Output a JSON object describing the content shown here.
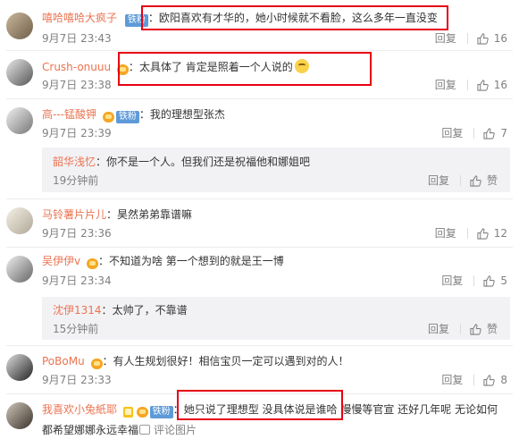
{
  "fan_badge_label": "铁粉",
  "reply_label": "回复",
  "like_label": "赞",
  "footer_link": "评论图片",
  "comments": [
    {
      "user": "嘻哈嘻哈大疯子",
      "text": "欧阳喜欢有才华的，她小时候就不看脸，这么多年一直没变",
      "time": "9月7日 23:43",
      "likes": "16"
    },
    {
      "user": "Crush-onuuu",
      "text": "太具体了 肯定是照着一个人说的",
      "time": "9月7日 23:38",
      "likes": "16"
    },
    {
      "user": "高---锰酸钾",
      "text": "我的理想型张杰",
      "time": "9月7日 23:39",
      "likes": "7",
      "reply": {
        "user": "韶华浅忆",
        "text": "你不是一个人。但我们还是祝福他和娜姐吧",
        "time": "19分钟前"
      }
    },
    {
      "user": "马铃薯片片儿",
      "text": "昊然弟弟靠谱嘛",
      "time": "9月7日 23:36",
      "likes": "12"
    },
    {
      "user": "吴伊伊v",
      "text": "不知道为啥 第一个想到的就是王一博",
      "time": "9月7日 23:34",
      "likes": "5",
      "reply": {
        "user": "沈伊1314",
        "text": "太帅了，不靠谱",
        "time": "15分钟前"
      }
    },
    {
      "user": "PoBoMu",
      "text": "有人生规划很好！相信宝贝一定可以遇到对的人！",
      "time": "9月7日 23:33",
      "likes": "8"
    },
    {
      "user": "我喜欢小兔紙耶",
      "text": "她只说了理想型 没具体说是谁哈 慢慢等官宣 还好几年呢 无论如何",
      "text2": "都希望娜娜永远幸福"
    }
  ]
}
